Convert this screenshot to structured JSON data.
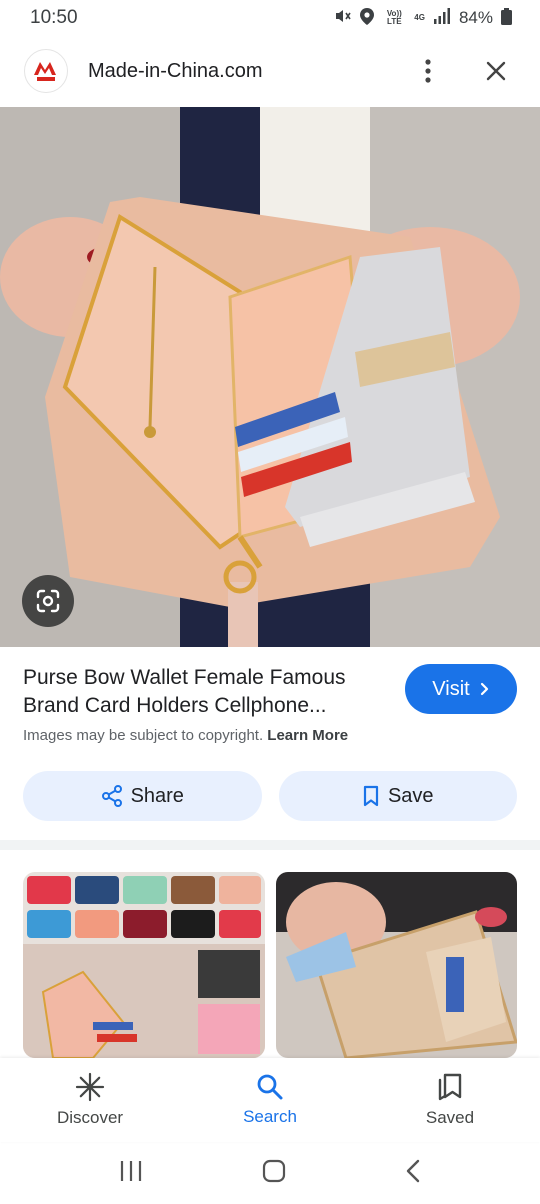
{
  "status_bar": {
    "time": "10:50",
    "signal_label_top": "Vo)) LTE",
    "network": "4G",
    "battery": "84%"
  },
  "app_bar": {
    "site_name": "Made-in-China.com",
    "logo_text": "M"
  },
  "result": {
    "title": "Purse Bow Wallet Female Famous Brand Card Holders Cellphone...",
    "visit_label": "Visit",
    "copyright_text": "Images may be subject to copyright.",
    "learn_more": "Learn More"
  },
  "actions": {
    "share_label": "Share",
    "save_label": "Save"
  },
  "bottom_nav": {
    "items": [
      {
        "label": "Discover",
        "icon": "asterisk-icon"
      },
      {
        "label": "Search",
        "icon": "search-icon",
        "active": true
      },
      {
        "label": "Saved",
        "icon": "saved-collection-icon"
      }
    ]
  },
  "colors": {
    "accent": "#1a73e8",
    "pill_bg": "#e8f0fe",
    "brand_red": "#d7261e"
  }
}
